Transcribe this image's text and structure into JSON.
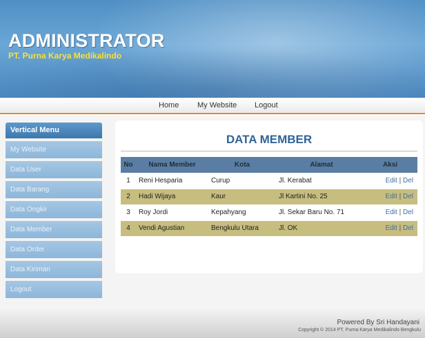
{
  "header": {
    "title": "ADMINISTRATOR",
    "subtitle": "PT. Purna Karya Medikalindo",
    "accent_color": "#ffe030",
    "bg_color": "#5b98cc"
  },
  "nav": {
    "items": [
      {
        "label": "Home"
      },
      {
        "label": "My Website"
      },
      {
        "label": "Logout"
      }
    ],
    "underline_color": "#e08a2c"
  },
  "sidebar": {
    "heading": "Vertical Menu",
    "items": [
      {
        "label": "My Website"
      },
      {
        "label": "Data User"
      },
      {
        "label": "Data Barang"
      },
      {
        "label": "Data Ongkir"
      },
      {
        "label": "Data Member"
      },
      {
        "label": "Data Order"
      },
      {
        "label": "Data Kiriman"
      },
      {
        "label": "Logout"
      }
    ]
  },
  "main": {
    "title": "DATA MEMBER",
    "table": {
      "columns": [
        "No",
        "Nama Member",
        "Kota",
        "Alamat",
        "Aksi"
      ],
      "rows": [
        {
          "no": "1",
          "nama": "Reni Hesparia",
          "kota": "Curup",
          "alamat": "Jl. Kerabat",
          "edit": "Edit",
          "sep": "|",
          "del": "Del"
        },
        {
          "no": "2",
          "nama": "Hadi Wijaya",
          "kota": "Kaur",
          "alamat": "Jl Kartini No. 25",
          "edit": "Edit",
          "sep": "|",
          "del": "Del"
        },
        {
          "no": "3",
          "nama": "Roy Jordi",
          "kota": "Kepahyang",
          "alamat": "Jl. Sekar Baru No. 71",
          "edit": "Edit",
          "sep": "|",
          "del": "Del"
        },
        {
          "no": "4",
          "nama": "Vendi Agustian",
          "kota": "Bengkulu Utara",
          "alamat": "Jl. OK",
          "edit": "Edit",
          "sep": "|",
          "del": "Del"
        }
      ],
      "header_color": "#5a7ea3",
      "stripe_color": "#c6bd7f"
    }
  },
  "footer": {
    "powered": "Powered By Sri Handayani",
    "copyright": "Copyright © 2014 PT. Purna Karya Medikalindo Bengkulu"
  }
}
